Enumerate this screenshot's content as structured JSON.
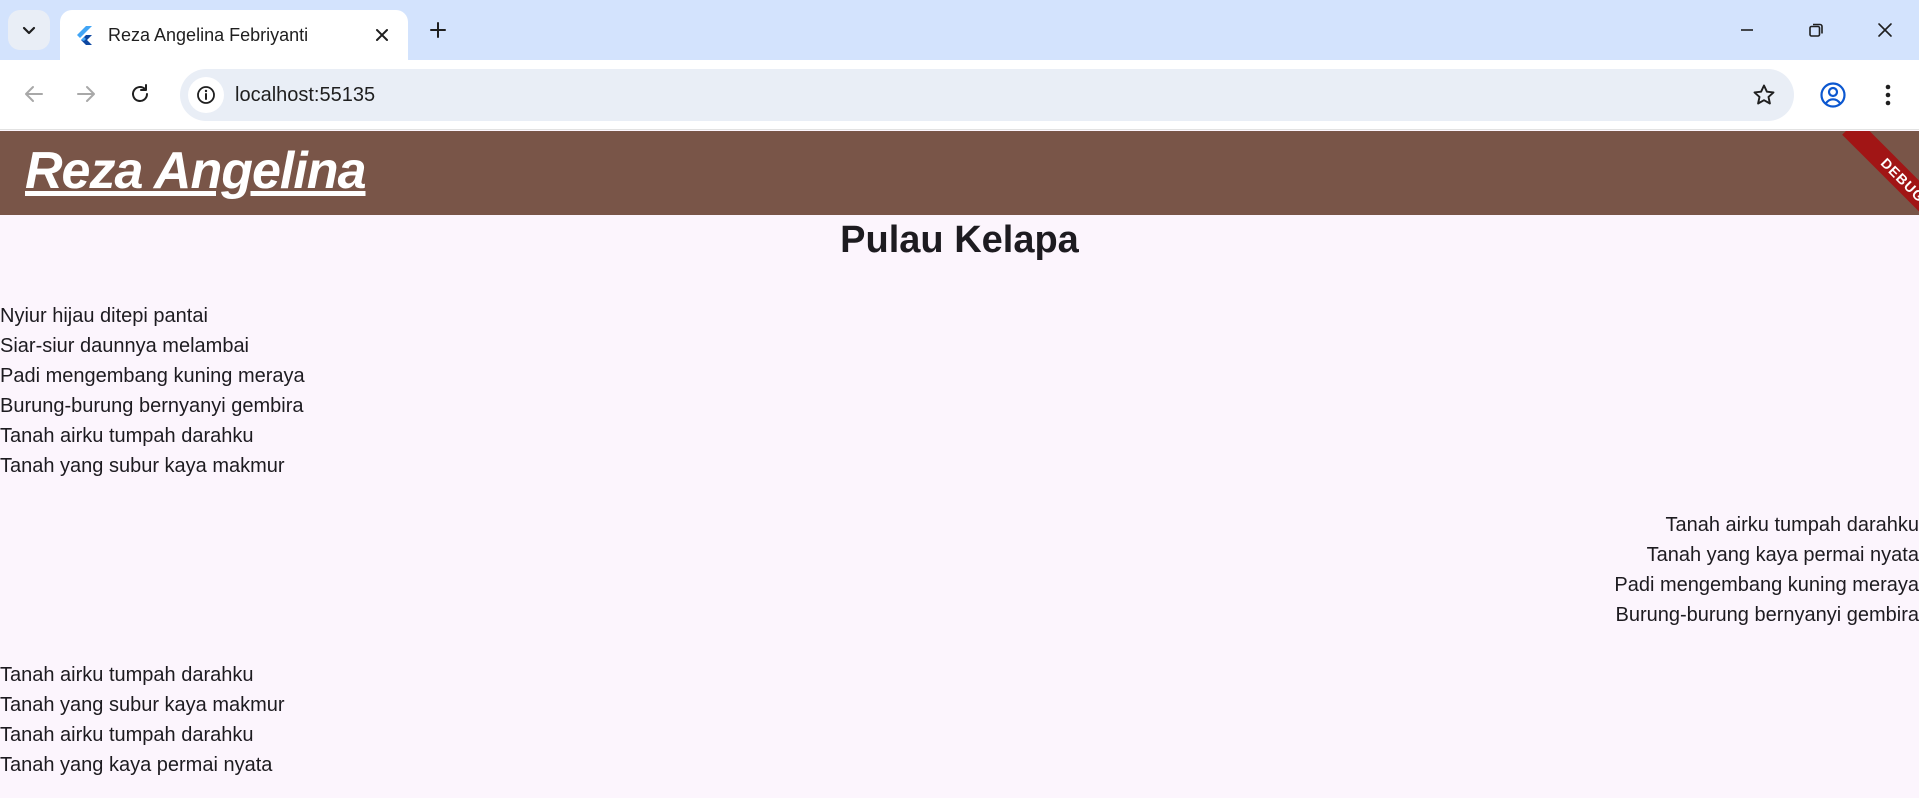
{
  "browser": {
    "tab_title": "Reza Angelina Febriyanti",
    "url": "localhost:55135"
  },
  "app": {
    "title": "Reza Angelina",
    "debug_label": "DEBUG",
    "appbar_color": "#795548",
    "background_color": "#fcf5fd"
  },
  "poem": {
    "title": "Pulau Kelapa",
    "stanza1": [
      "Nyiur hijau ditepi pantai",
      "Siar-siur daunnya melambai",
      "Padi mengembang kuning meraya",
      "Burung-burung bernyanyi gembira",
      "Tanah airku tumpah darahku",
      "Tanah yang subur kaya makmur"
    ],
    "stanza2": [
      "Tanah airku tumpah darahku",
      "Tanah yang kaya permai nyata",
      "Padi mengembang kuning meraya",
      "Burung-burung bernyanyi gembira"
    ],
    "stanza3": [
      "Tanah airku tumpah darahku",
      "Tanah yang subur kaya makmur",
      "Tanah airku tumpah darahku",
      "Tanah yang kaya permai nyata"
    ]
  }
}
